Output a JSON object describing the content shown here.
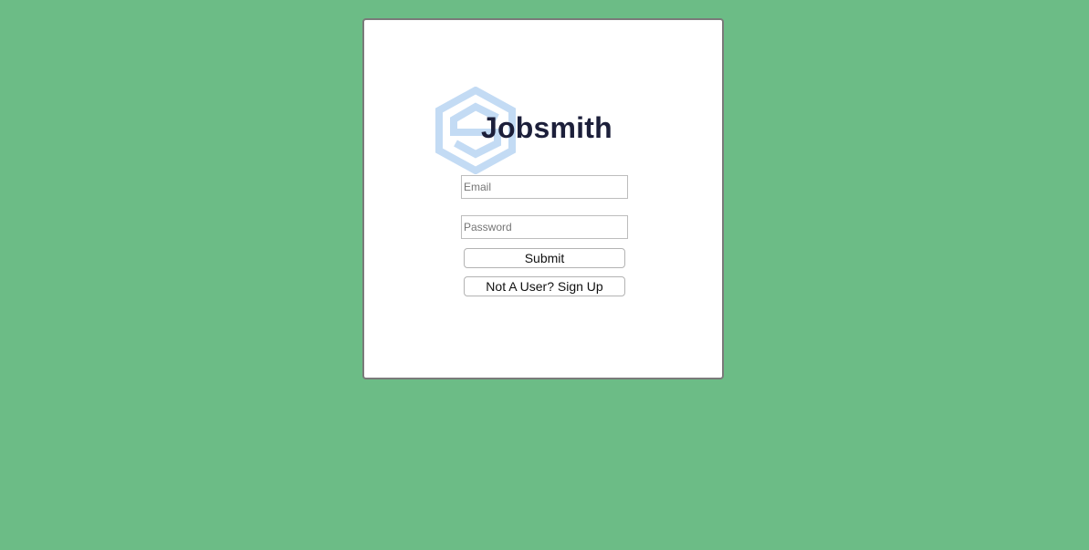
{
  "page": {
    "background_color": "#6cbc86"
  },
  "card": {
    "brand_name": "Jobsmith",
    "logo_icon": "hexagon-s-logo-icon",
    "logo_color": "#c3dbf4"
  },
  "form": {
    "email_placeholder": "Email",
    "email_value": "",
    "password_placeholder": "Password",
    "password_value": "",
    "submit_label": "Submit",
    "signup_label": "Not A User? Sign Up"
  }
}
